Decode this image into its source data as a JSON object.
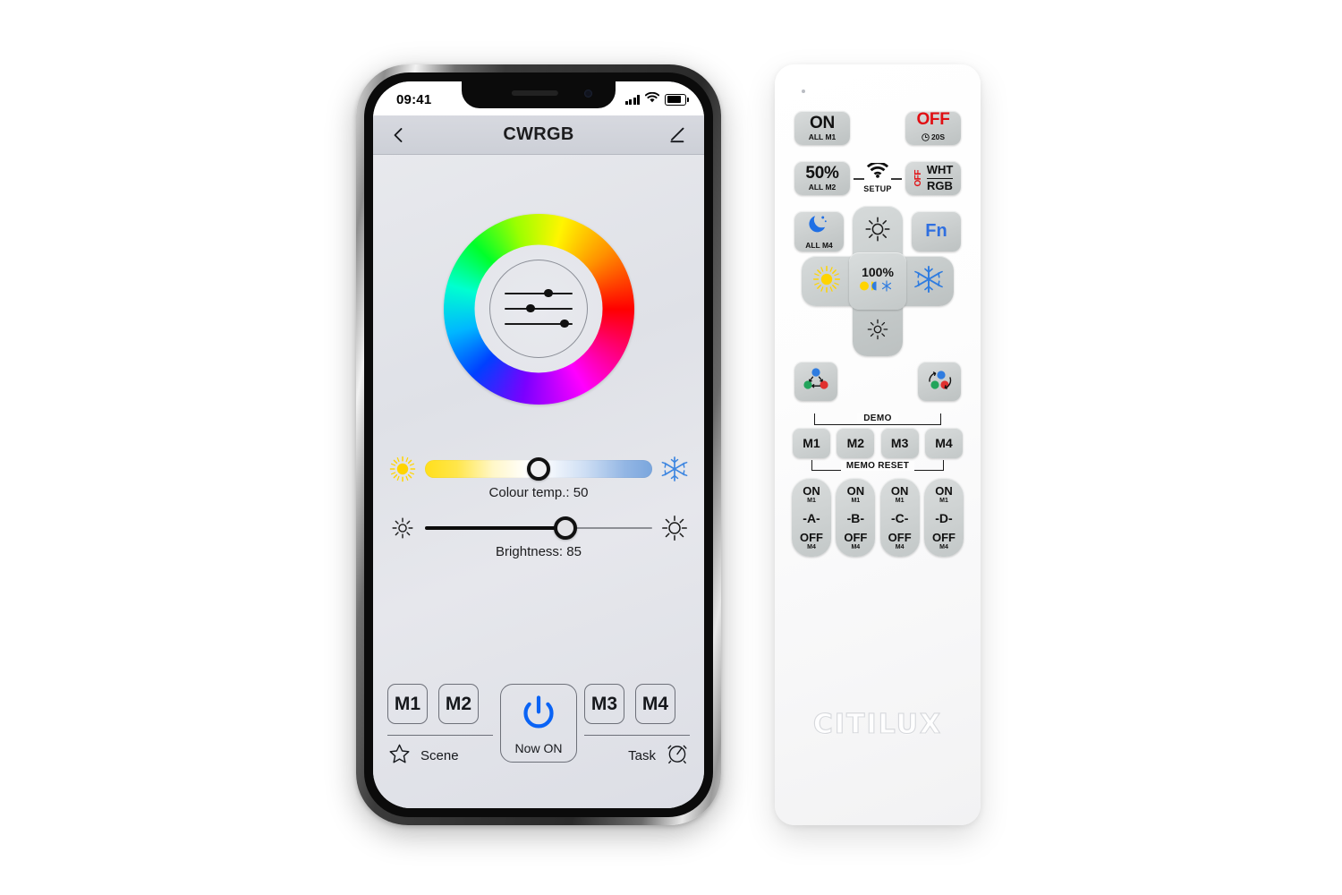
{
  "phone": {
    "status_bar": {
      "time": "09:41",
      "signal_icon": "cellular-bars-icon",
      "wifi_icon": "wifi-icon",
      "battery_icon": "battery-icon"
    },
    "nav": {
      "back_icon": "back-arrow-icon",
      "title": "CWRGB",
      "edit_icon": "pencil-edit-icon"
    },
    "color_wheel": {
      "name": "colour-wheel",
      "center_icon": "sliders-icon",
      "slider_positions": [
        62,
        48,
        80
      ]
    },
    "colour_temp": {
      "left_icon": "warm-sun-icon",
      "right_icon": "snowflake-icon",
      "label": "Colour temp.: 50",
      "value": 50
    },
    "brightness": {
      "left_icon": "low-brightness-icon",
      "right_icon": "high-brightness-icon",
      "label": "Brightness: 85",
      "value": 85
    },
    "memory_buttons": [
      "M1",
      "M2",
      "M3",
      "M4"
    ],
    "power": {
      "icon": "power-icon",
      "label": "Now ON"
    },
    "scene": {
      "icon": "star-icon",
      "label": "Scene"
    },
    "task": {
      "label": "Task",
      "icon": "alarm-clock-icon"
    }
  },
  "remote": {
    "ir_led": "ir-led-dot",
    "buttons": {
      "on": {
        "main": "ON",
        "sub": "ALL M1"
      },
      "off": {
        "main": "OFF",
        "sub": "20S",
        "clock_icon": "clock-icon"
      },
      "half": {
        "main": "50%",
        "sub": "ALL M2"
      },
      "wht_rgb": {
        "off": "OFF",
        "top": "WHT",
        "bottom": "RGB"
      },
      "setup": {
        "label": "SETUP",
        "icon": "wifi-setup-icon"
      },
      "moon": {
        "icon": "moon-icon",
        "sub": "ALL M4"
      },
      "fn": {
        "label": "Fn"
      },
      "cross": {
        "up_icon": "sun-bright-icon",
        "down_icon": "sun-dim-icon",
        "left_icon": "warm-sun-icon",
        "right_icon": "snowflake-icon",
        "center": {
          "label": "100%",
          "icons": "warm-cool-toggle-icon"
        }
      },
      "demo_left": {
        "icon": "rgb-cycle-icon"
      },
      "demo_right": {
        "icon": "rgb-rotate-icon"
      },
      "demo_label": "DEMO",
      "memo": [
        "M1",
        "M2",
        "M3",
        "M4"
      ],
      "memo_label": "MEMO RESET",
      "channels": [
        {
          "on": "ON",
          "on_sub": "M1",
          "mid": "-A-",
          "off": "OFF",
          "off_sub": "M4"
        },
        {
          "on": "ON",
          "on_sub": "M1",
          "mid": "-B-",
          "off": "OFF",
          "off_sub": "M4"
        },
        {
          "on": "ON",
          "on_sub": "M1",
          "mid": "-C-",
          "off": "OFF",
          "off_sub": "M4"
        },
        {
          "on": "ON",
          "on_sub": "M1",
          "mid": "-D-",
          "off": "OFF",
          "off_sub": "M4"
        }
      ]
    },
    "brand": "CITILUX"
  },
  "colors": {
    "accent_blue": "#2f6fe0",
    "red": "#e10f13",
    "yellow": "#ffd400",
    "snow_blue": "#3d86e0",
    "button_gray": "#cfd3d3"
  }
}
